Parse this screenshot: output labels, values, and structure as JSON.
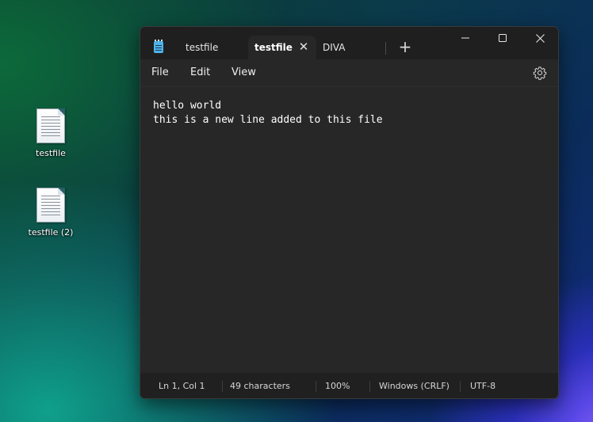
{
  "desktop": {
    "icons": [
      {
        "label": "testfile"
      },
      {
        "label": "testfile (2)"
      }
    ]
  },
  "notepad": {
    "tabs": [
      {
        "label": "testfile",
        "active": false
      },
      {
        "label": "testfile",
        "active": true
      },
      {
        "label": "DIVA",
        "active": false
      }
    ],
    "new_tab_glyph": "+",
    "tab_close_glyph": "✕",
    "menu": {
      "file": "File",
      "edit": "Edit",
      "view": "View"
    },
    "editor": {
      "lines": [
        "hello world",
        "this is a new line added to this file"
      ]
    },
    "status": {
      "position": "Ln 1, Col 1",
      "characters": "49 characters",
      "zoom": "100%",
      "line_ending": "Windows (CRLF)",
      "encoding": "UTF-8"
    },
    "icons": {
      "app": "notepad-icon",
      "settings": "gear-icon",
      "minimize": "minimize-icon",
      "maximize": "maximize-icon",
      "close": "close-icon"
    }
  }
}
